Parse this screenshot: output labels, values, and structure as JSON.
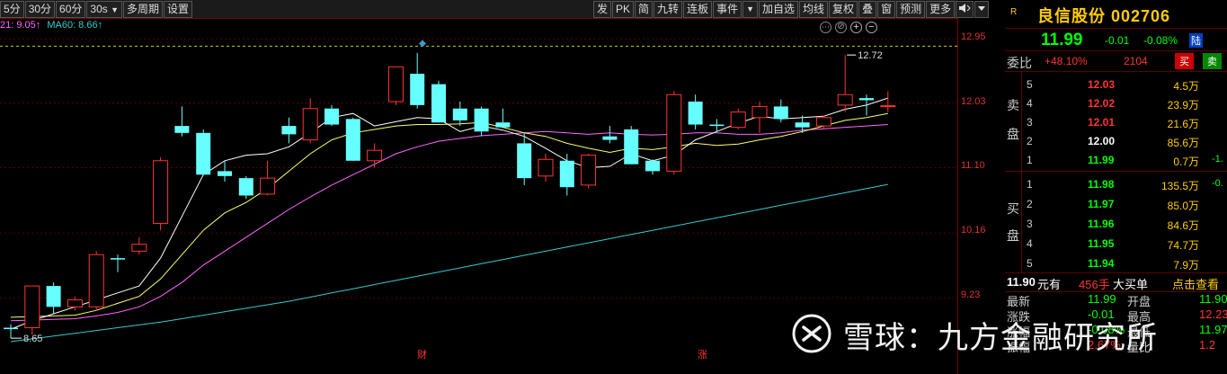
{
  "toolbar": {
    "left": [
      "5分",
      "30分",
      "60分",
      "30s",
      "多周期",
      "设置"
    ],
    "dropdown_glyph": "▼",
    "right": [
      "发",
      "PK",
      "简",
      "九转",
      "连板",
      "事件",
      "加自选",
      "均线",
      "复权",
      "叠",
      "窗",
      "预测",
      "更多"
    ],
    "right_icons": [
      "speaker-icon",
      "dropdown-icon"
    ]
  },
  "ma_legend": [
    {
      "text": "21: 9.05↑",
      "color": "#ff66ff"
    },
    {
      "text": "MA60: 8.66↑",
      "color": "#33cccc"
    }
  ],
  "price_axis": [
    "12.95",
    "12.03",
    "11.10",
    "10.16",
    "9.23"
  ],
  "annotations": {
    "high": "12.72",
    "low": "8.65",
    "event1": "财",
    "event2": "涨"
  },
  "chart_icons": [
    "zoom-out-icon",
    "zoom-in-icon",
    "close-icon"
  ],
  "colors": {
    "up": "#ff3333",
    "down": "#66ffff",
    "ma5": "#ffffff",
    "ma10": "#ffff66",
    "ma20": "#ff66ff",
    "ma60": "#33cccc",
    "guide": "#ffff00"
  },
  "chart_data": {
    "type": "candlestick",
    "ylim": [
      8.6,
      13.2
    ],
    "candles": [
      {
        "o": 8.8,
        "h": 8.85,
        "l": 8.65,
        "c": 8.78
      },
      {
        "o": 8.8,
        "h": 9.4,
        "l": 8.7,
        "c": 9.4
      },
      {
        "o": 9.4,
        "h": 9.45,
        "l": 9.0,
        "c": 9.1
      },
      {
        "o": 9.1,
        "h": 9.25,
        "l": 9.05,
        "c": 9.2
      },
      {
        "o": 9.1,
        "h": 9.9,
        "l": 9.05,
        "c": 9.85
      },
      {
        "o": 9.8,
        "h": 9.85,
        "l": 9.6,
        "c": 9.78
      },
      {
        "o": 9.9,
        "h": 10.1,
        "l": 9.85,
        "c": 10.0
      },
      {
        "o": 10.3,
        "h": 11.25,
        "l": 10.2,
        "c": 11.2
      },
      {
        "o": 11.7,
        "h": 11.98,
        "l": 11.55,
        "c": 11.6
      },
      {
        "o": 11.6,
        "h": 11.65,
        "l": 11.0,
        "c": 11.0
      },
      {
        "o": 11.05,
        "h": 11.2,
        "l": 10.9,
        "c": 10.98
      },
      {
        "o": 10.95,
        "h": 10.98,
        "l": 10.65,
        "c": 10.7
      },
      {
        "o": 10.72,
        "h": 11.2,
        "l": 10.7,
        "c": 10.95
      },
      {
        "o": 11.7,
        "h": 11.82,
        "l": 11.45,
        "c": 11.58
      },
      {
        "o": 11.5,
        "h": 12.1,
        "l": 11.45,
        "c": 11.95
      },
      {
        "o": 11.95,
        "h": 12.0,
        "l": 11.7,
        "c": 11.72
      },
      {
        "o": 11.8,
        "h": 11.82,
        "l": 11.2,
        "c": 11.2
      },
      {
        "o": 11.2,
        "h": 11.45,
        "l": 11.1,
        "c": 11.35
      },
      {
        "o": 12.05,
        "h": 12.55,
        "l": 12.0,
        "c": 12.55
      },
      {
        "o": 12.45,
        "h": 12.75,
        "l": 11.95,
        "c": 12.0
      },
      {
        "o": 12.3,
        "h": 12.35,
        "l": 11.75,
        "c": 11.75
      },
      {
        "o": 11.95,
        "h": 12.05,
        "l": 11.7,
        "c": 11.78
      },
      {
        "o": 11.95,
        "h": 11.98,
        "l": 11.55,
        "c": 11.62
      },
      {
        "o": 11.75,
        "h": 11.95,
        "l": 11.7,
        "c": 11.68
      },
      {
        "o": 11.45,
        "h": 11.6,
        "l": 10.85,
        "c": 10.95
      },
      {
        "o": 10.98,
        "h": 11.3,
        "l": 10.9,
        "c": 11.22
      },
      {
        "o": 11.2,
        "h": 11.3,
        "l": 10.7,
        "c": 10.82
      },
      {
        "o": 10.85,
        "h": 11.3,
        "l": 10.8,
        "c": 11.28
      },
      {
        "o": 11.55,
        "h": 11.7,
        "l": 11.45,
        "c": 11.5
      },
      {
        "o": 11.65,
        "h": 11.7,
        "l": 11.15,
        "c": 11.15
      },
      {
        "o": 11.2,
        "h": 11.22,
        "l": 11.0,
        "c": 11.05
      },
      {
        "o": 11.05,
        "h": 12.2,
        "l": 11.0,
        "c": 12.15
      },
      {
        "o": 12.05,
        "h": 12.15,
        "l": 11.65,
        "c": 11.72
      },
      {
        "o": 11.72,
        "h": 11.8,
        "l": 11.62,
        "c": 11.7
      },
      {
        "o": 11.68,
        "h": 11.95,
        "l": 11.65,
        "c": 11.9
      },
      {
        "o": 11.82,
        "h": 12.05,
        "l": 11.6,
        "c": 11.98
      },
      {
        "o": 11.98,
        "h": 12.08,
        "l": 11.75,
        "c": 11.8
      },
      {
        "o": 11.75,
        "h": 11.85,
        "l": 11.6,
        "c": 11.68
      },
      {
        "o": 11.7,
        "h": 11.85,
        "l": 11.65,
        "c": 11.82
      },
      {
        "o": 12.0,
        "h": 12.72,
        "l": 11.9,
        "c": 12.15
      },
      {
        "o": 12.1,
        "h": 12.15,
        "l": 11.85,
        "c": 12.07
      },
      {
        "o": 11.99,
        "h": 12.2,
        "l": 11.9,
        "c": 11.99
      }
    ],
    "ma5": [
      8.78,
      8.9,
      9.0,
      9.1,
      9.2,
      9.3,
      9.4,
      9.8,
      10.4,
      11.0,
      11.2,
      11.28,
      11.3,
      11.4,
      11.6,
      11.82,
      11.88,
      11.7,
      11.76,
      11.82,
      11.8,
      11.62,
      11.7,
      11.64,
      11.55,
      11.38,
      11.2,
      11.1,
      11.12,
      11.3,
      11.2,
      11.28,
      11.5,
      11.62,
      11.74,
      11.84,
      11.8,
      11.82,
      11.84,
      11.94,
      12.0,
      12.1
    ],
    "ma10": [
      8.95,
      8.96,
      8.97,
      8.98,
      9.05,
      9.15,
      9.25,
      9.5,
      9.85,
      10.2,
      10.45,
      10.6,
      10.8,
      11.05,
      11.3,
      11.5,
      11.6,
      11.65,
      11.7,
      11.72,
      11.72,
      11.73,
      11.75,
      11.68,
      11.6,
      11.55,
      11.45,
      11.38,
      11.32,
      11.38,
      11.36,
      11.4,
      11.45,
      11.42,
      11.44,
      11.5,
      11.55,
      11.62,
      11.7,
      11.78,
      11.82,
      11.88
    ],
    "ma20": [
      8.9,
      8.91,
      8.92,
      8.93,
      8.97,
      9.02,
      9.1,
      9.25,
      9.45,
      9.7,
      9.9,
      10.1,
      10.3,
      10.5,
      10.68,
      10.85,
      11.0,
      11.15,
      11.3,
      11.4,
      11.48,
      11.52,
      11.56,
      11.58,
      11.6,
      11.62,
      11.6,
      11.58,
      11.6,
      11.58,
      11.57,
      11.58,
      11.6,
      11.6,
      11.58,
      11.58,
      11.6,
      11.64,
      11.66,
      11.68,
      11.7,
      11.72
    ],
    "ma60": [
      8.6,
      8.64,
      8.68,
      8.72,
      8.76,
      8.8,
      8.84,
      8.88,
      8.93,
      8.98,
      9.03,
      9.08,
      9.13,
      9.18,
      9.24,
      9.3,
      9.36,
      9.42,
      9.48,
      9.54,
      9.6,
      9.66,
      9.72,
      9.78,
      9.84,
      9.9,
      9.96,
      10.02,
      10.08,
      10.14,
      10.2,
      10.26,
      10.32,
      10.38,
      10.44,
      10.5,
      10.56,
      10.62,
      10.68,
      10.74,
      10.8,
      10.86
    ]
  },
  "quote": {
    "market_flag": "R",
    "name": "良信股份 002706",
    "price": "11.99",
    "change": "-0.01",
    "change_pct": "-0.08%",
    "market": "陆"
  },
  "weibi": {
    "label": "委比",
    "ratio": "+48.10%",
    "diff": "2104",
    "buy_btn": "买",
    "sell_btn": "卖"
  },
  "ask": {
    "label1": "卖",
    "label2": "盘",
    "rows": [
      {
        "n": "5",
        "p": "12.03",
        "q": "4.5万",
        "c": ""
      },
      {
        "n": "4",
        "p": "12.02",
        "q": "23.9万",
        "c": ""
      },
      {
        "n": "3",
        "p": "12.01",
        "q": "21.6万",
        "c": ""
      },
      {
        "n": "2",
        "p": "12.00",
        "q": "85.6万",
        "c": ""
      },
      {
        "n": "1",
        "p": "11.99",
        "q": "0.7万",
        "c": "-1."
      }
    ]
  },
  "bid": {
    "label1": "买",
    "label2": "盘",
    "rows": [
      {
        "n": "1",
        "p": "11.98",
        "q": "135.5万",
        "c": "-0."
      },
      {
        "n": "2",
        "p": "11.97",
        "q": "85.0万",
        "c": ""
      },
      {
        "n": "3",
        "p": "11.96",
        "q": "84.6万",
        "c": ""
      },
      {
        "n": "4",
        "p": "11.95",
        "q": "74.7万",
        "c": ""
      },
      {
        "n": "5",
        "p": "11.94",
        "q": "7.9万",
        "c": ""
      }
    ]
  },
  "trade": {
    "price": "11.90",
    "unit": "元有",
    "hands": "456手",
    "type": "大买单",
    "link": "点击查看"
  },
  "stats": [
    {
      "l": "最新",
      "v": "11.99",
      "l2": "开盘",
      "v2": "11.90"
    },
    {
      "l": "涨跌",
      "v": "-0.01",
      "l2": "最高",
      "v2": "12.23"
    },
    {
      "l": "涨幅",
      "v": "-0.08%",
      "l2": "最低",
      "v2": "11.97"
    },
    {
      "l": "振幅",
      "v": "2.67%",
      "l2": "量比",
      "v2": "1.2"
    }
  ],
  "watermark": "雪球：九方金融研究所"
}
